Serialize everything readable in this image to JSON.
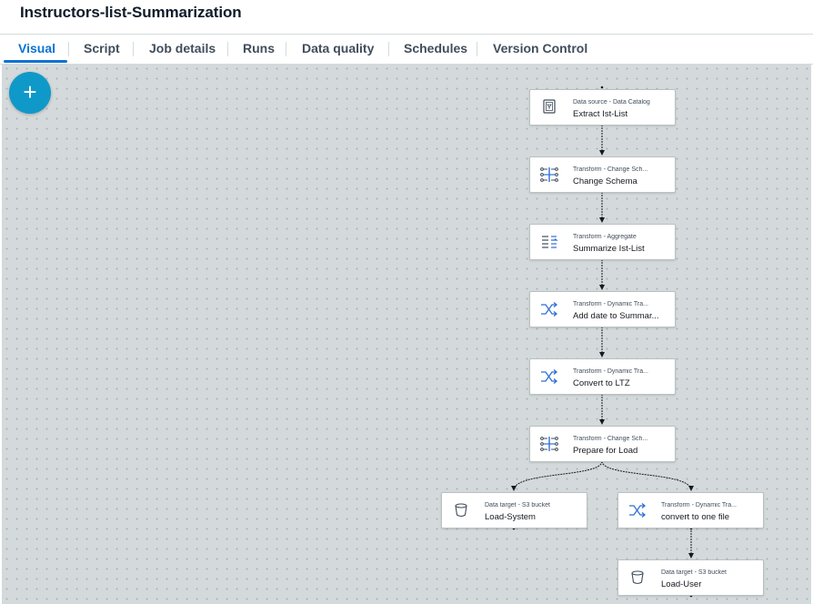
{
  "page": {
    "title": "Instructors-list-Summarization"
  },
  "tabs": [
    {
      "label": "Visual",
      "active": true
    },
    {
      "label": "Script"
    },
    {
      "label": "Job details"
    },
    {
      "label": "Runs"
    },
    {
      "label": "Data quality"
    },
    {
      "label": "Schedules"
    },
    {
      "label": "Version Control"
    }
  ],
  "canvas": {
    "add_button_label": "+",
    "nodes": [
      {
        "type": "Data source - Data Catalog",
        "name": "Extract Ist-List",
        "icon": "data-catalog-icon"
      },
      {
        "type": "Transform - Change Sch...",
        "name": "Change Schema",
        "icon": "change-schema-icon"
      },
      {
        "type": "Transform - Aggregate",
        "name": "Summarize Ist-List",
        "icon": "aggregate-icon"
      },
      {
        "type": "Transform - Dynamic Tra...",
        "name": "Add date to Summar...",
        "icon": "dynamic-transform-icon"
      },
      {
        "type": "Transform - Dynamic Tra...",
        "name": "Convert to LTZ",
        "icon": "dynamic-transform-icon"
      },
      {
        "type": "Transform - Change Sch...",
        "name": "Prepare for Load",
        "icon": "change-schema-icon"
      },
      {
        "type": "Data target - S3 bucket",
        "name": "Load-System",
        "icon": "s3-bucket-icon"
      },
      {
        "type": "Transform - Dynamic Tra...",
        "name": "convert to one file",
        "icon": "dynamic-transform-icon"
      },
      {
        "type": "Data target - S3 bucket",
        "name": "Load-User",
        "icon": "s3-bucket-icon"
      }
    ]
  },
  "colors": {
    "accent": "#0972d3",
    "add_button": "#0f99c9",
    "canvas_background": "#d4dadb",
    "icon_blue": "#2f6fd6"
  }
}
